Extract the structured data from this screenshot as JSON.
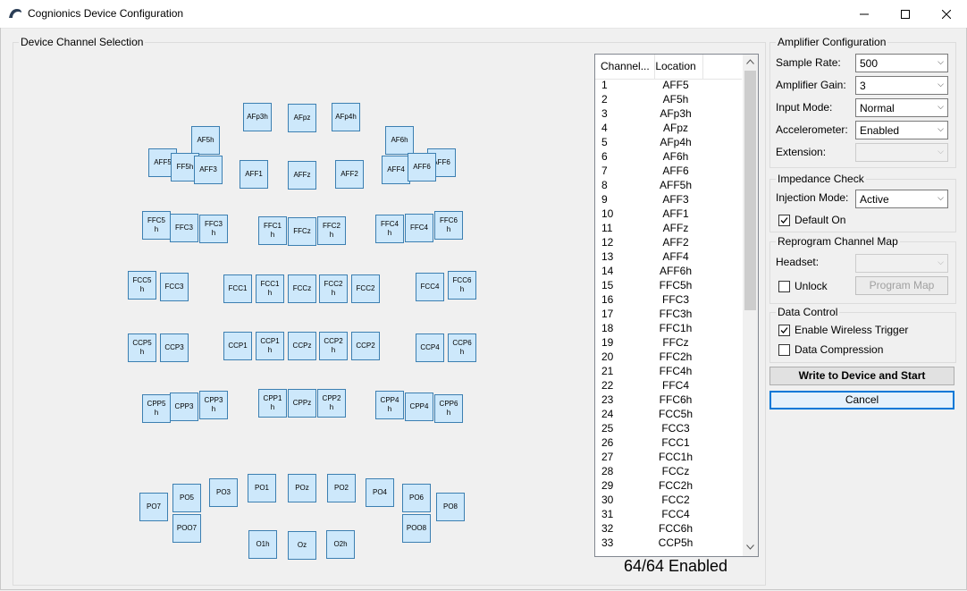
{
  "window": {
    "title": "Cognionics Device Configuration"
  },
  "channel_selection": {
    "title": "Device Channel Selection"
  },
  "electrodes": [
    "AFp3h",
    "AFpz",
    "AFp4h",
    "AF5h",
    "AF6h",
    "AFF5",
    "FF5h",
    "AFF3",
    "AFF1",
    "AFFz",
    "AFF2",
    "AFF4",
    "AFF6",
    "FFC5\nh",
    "FFC3",
    "FFC3\nh",
    "FFC1\nh",
    "FFCz",
    "FFC2\nh",
    "FFC4\nh",
    "FFC4",
    "FFC6\nh",
    "FCC5\nh",
    "FCC3",
    "FCC1",
    "FCC1\nh",
    "FCCz",
    "FCC2\nh",
    "FCC2",
    "FCC4",
    "FCC6\nh",
    "CCP5\nh",
    "CCP3",
    "CCP1",
    "CCP1\nh",
    "CCPz",
    "CCP2\nh",
    "CCP2",
    "CCP4",
    "CCP6\nh",
    "CPP5\nh",
    "CPP3",
    "CPP3\nh",
    "CPP1\nh",
    "CPPz",
    "CPP2\nh",
    "CPP4\nh",
    "CPP4",
    "CPP6\nh",
    "PO7",
    "PO5",
    "PO3",
    "PO1",
    "POz",
    "PO2",
    "PO4",
    "PO6",
    "PO8",
    "POO7",
    "POO8",
    "O1h",
    "Oz",
    "O2h",
    "AFF6"
  ],
  "channel_list": {
    "header_channel": "Channel...",
    "header_location": "Location",
    "rows": [
      [
        "1",
        "AFF5"
      ],
      [
        "2",
        "AF5h"
      ],
      [
        "3",
        "AFp3h"
      ],
      [
        "4",
        "AFpz"
      ],
      [
        "5",
        "AFp4h"
      ],
      [
        "6",
        "AF6h"
      ],
      [
        "7",
        "AFF6"
      ],
      [
        "8",
        "AFF5h"
      ],
      [
        "9",
        "AFF3"
      ],
      [
        "10",
        "AFF1"
      ],
      [
        "11",
        "AFFz"
      ],
      [
        "12",
        "AFF2"
      ],
      [
        "13",
        "AFF4"
      ],
      [
        "14",
        "AFF6h"
      ],
      [
        "15",
        "FFC5h"
      ],
      [
        "16",
        "FFC3"
      ],
      [
        "17",
        "FFC3h"
      ],
      [
        "18",
        "FFC1h"
      ],
      [
        "19",
        "FFCz"
      ],
      [
        "20",
        "FFC2h"
      ],
      [
        "21",
        "FFC4h"
      ],
      [
        "22",
        "FFC4"
      ],
      [
        "23",
        "FFC6h"
      ],
      [
        "24",
        "FCC5h"
      ],
      [
        "25",
        "FCC3"
      ],
      [
        "26",
        "FCC1"
      ],
      [
        "27",
        "FCC1h"
      ],
      [
        "28",
        "FCCz"
      ],
      [
        "29",
        "FCC2h"
      ],
      [
        "30",
        "FCC2"
      ],
      [
        "31",
        "FCC4"
      ],
      [
        "32",
        "FCC6h"
      ],
      [
        "33",
        "CCP5h"
      ]
    ],
    "status": "64/64 Enabled"
  },
  "amplifier": {
    "title": "Amplifier Configuration",
    "sample_rate_label": "Sample Rate:",
    "sample_rate": "500",
    "gain_label": "Amplifier Gain:",
    "gain": "3",
    "input_mode_label": "Input Mode:",
    "input_mode": "Normal",
    "accel_label": "Accelerometer:",
    "accel": "Enabled",
    "extension_label": "Extension:",
    "extension": ""
  },
  "impedance": {
    "title": "Impedance Check",
    "injection_label": "Injection Mode:",
    "injection": "Active",
    "default_on_label": "Default On",
    "default_on": true
  },
  "reprogram": {
    "title": "Reprogram Channel Map",
    "headset_label": "Headset:",
    "headset": "",
    "unlock_label": "Unlock",
    "unlock": false,
    "program_map_label": "Program Map"
  },
  "data_control": {
    "title": "Data Control",
    "wireless_label": "Enable Wireless Trigger",
    "wireless": true,
    "compression_label": "Data Compression",
    "compression": false
  },
  "buttons": {
    "write": "Write to Device and Start",
    "cancel": "Cancel"
  },
  "colors": {
    "electrode_fill": "#cde8fb",
    "electrode_border": "#3c7fb1",
    "button_focus": "#0078d7"
  }
}
